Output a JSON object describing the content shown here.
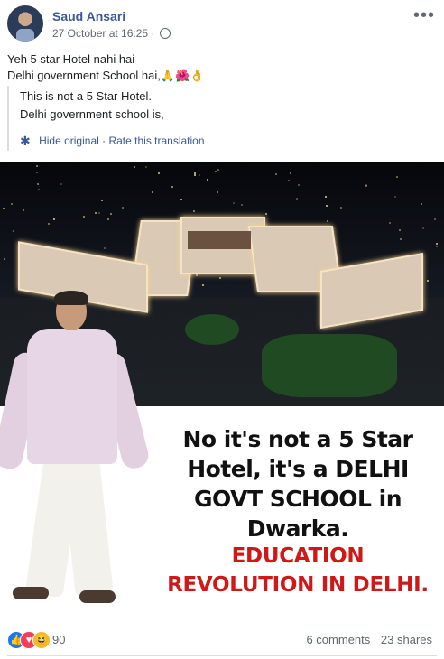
{
  "post": {
    "author": "Saud Ansari",
    "timestamp": "27 October at 16:25",
    "separator": "·",
    "more_label": "•••",
    "text_line1": "Yeh 5 star Hotel nahi hai",
    "text_line2": "Delhi government School hai,🙏🌺👌"
  },
  "translation": {
    "line1": "This is not a 5 Star Hotel.",
    "line2": "Delhi government school is,",
    "hide_label": "Hide original",
    "dot": "·",
    "rate_label": "Rate this translation"
  },
  "image": {
    "headline": "No it's not a 5 Star Hotel, it's a DELHI GOVT SCHOOL in Dwarka.",
    "subheadline": "EDUCATION REVOLUTION IN DELHI."
  },
  "footer": {
    "reaction_count": "90",
    "comments": "6 comments",
    "shares": "23 shares",
    "reactions": [
      "like-icon",
      "love-icon",
      "haha-icon"
    ]
  },
  "colors": {
    "link": "#385898",
    "headline_red": "#d01818",
    "like": "#1877f2",
    "love": "#f33e58",
    "haha": "#f7b928"
  }
}
